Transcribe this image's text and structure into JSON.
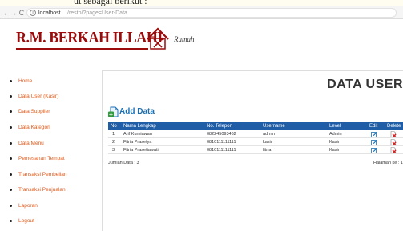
{
  "caption": "ut sebagai berikut :",
  "browser": {
    "back_glyph": "←",
    "forward_glyph": "→",
    "reload_glyph": "C",
    "info_glyph": "i",
    "url_host": "localhost",
    "url_path": "/resto/?page=User-Data"
  },
  "logo": {
    "title": "R.M. BERKAH ILLAHI",
    "subtitle": "Rumah",
    "brand_color": "#9b0b0b"
  },
  "sidebar": {
    "items": [
      {
        "label": "Home"
      },
      {
        "label": "Data User (Kasir)"
      },
      {
        "label": "Data Supplier"
      },
      {
        "label": "Data Kategori"
      },
      {
        "label": "Data Menu"
      },
      {
        "label": "Pemesanan Tempat"
      },
      {
        "label": "Transaksi Pembelian"
      },
      {
        "label": "Transaksi Penjualan"
      },
      {
        "label": "Laporan"
      },
      {
        "label": "Logout"
      }
    ],
    "link_color": "#e05a1a"
  },
  "main": {
    "title": "DATA USER",
    "add_button": "Add Data",
    "accent_color": "#1f5da6",
    "table": {
      "headers": [
        "No",
        "Nama Lengkap",
        "No. Telepon",
        "Username",
        "Level",
        "Edit",
        "Delete"
      ],
      "rows": [
        {
          "no": "1",
          "nama": "Arif Kurniawan",
          "telepon": "082245093462",
          "username": "admin",
          "level": "Admin"
        },
        {
          "no": "2",
          "nama": "Fitria Prasetya",
          "telepon": "0810111111111",
          "username": "kasir",
          "level": "Kasir"
        },
        {
          "no": "3",
          "nama": "Fitria Prasetiawati",
          "telepon": "0810111111111",
          "username": "fitria",
          "level": "Kasir"
        }
      ]
    },
    "jumlah_data": "Jumlah Data : 3",
    "halaman": "Halaman ke : 1"
  }
}
